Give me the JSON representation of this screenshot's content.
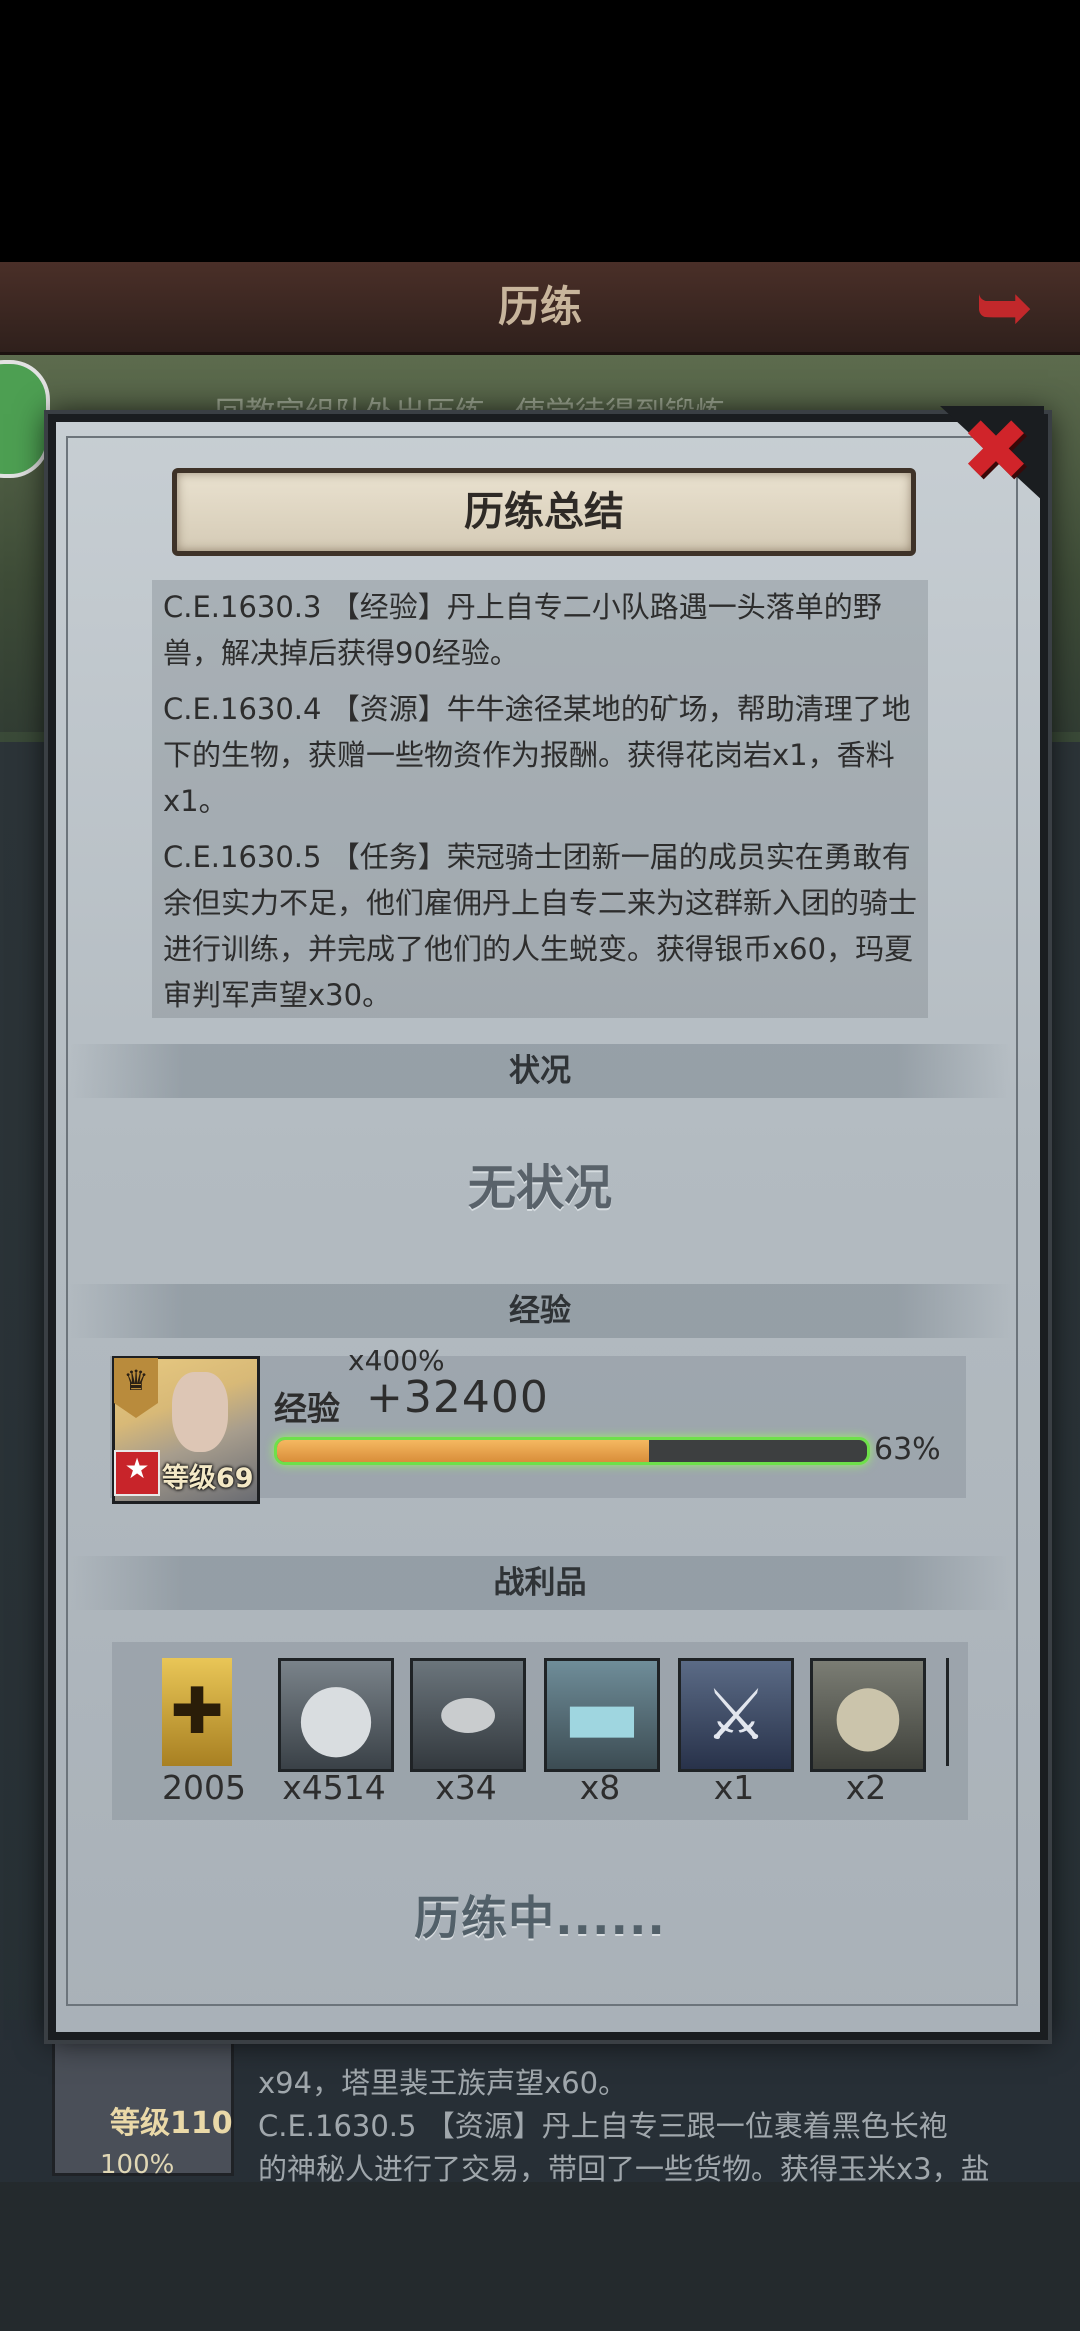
{
  "background": {
    "header_title": "历练",
    "banner_text": "回教宫组队外出历练，使学徒得到锻炼",
    "list_rows": [
      "x94，塔里裴王族声望x60。",
      "C.E.1630.5 【资源】丹上自专三跟一位裹着黑色长袍",
      "的神秘人进行了交易，带回了一些货物。获得玉米x3，盐"
    ],
    "second_hero_level": "等级110",
    "second_hero_pct": "100%"
  },
  "modal": {
    "title": "历练总结",
    "log": [
      "C.E.1630.3 【经验】丹上自专二小队路遇一头落单的野兽，解决掉后获得90经验。",
      "C.E.1630.4 【资源】牛牛途径某地的矿场，帮助清理了地下的生物，获赠一些物资作为报酬。获得花岗岩x1，香料x1。",
      "C.E.1630.5 【任务】荣冠骑士团新一届的成员实在勇敢有余但实力不足，他们雇佣丹上自专二来为这群新入团的骑士进行训练，并完成了他们的人生蜕变。获得银币x60，玛夏审判军声望x30。"
    ],
    "status_header": "状况",
    "status_value": "无状况",
    "exp_header": "经验",
    "hero": {
      "level": "等级69",
      "multiplier": "x400%",
      "exp_word": "经验",
      "exp_gain": "+32400",
      "progress": 0.63,
      "progress_label": "63%"
    },
    "loot_header": "战利品",
    "loot": [
      {
        "icon": "guild-banner-icon",
        "count": "2005"
      },
      {
        "icon": "silver-coin-icon",
        "count": "x4514"
      },
      {
        "icon": "metal-ore-icon",
        "count": "x34"
      },
      {
        "icon": "cloth-bolt-icon",
        "count": "x8"
      },
      {
        "icon": "winged-crest-icon",
        "count": "x1"
      },
      {
        "icon": "grain-sack-icon",
        "count": "x2"
      }
    ],
    "footer_status": "历练中......"
  },
  "colors": {
    "close_red": "#d0242a",
    "progress_green": "#6ee04a",
    "progress_fill": "#e39a42"
  }
}
